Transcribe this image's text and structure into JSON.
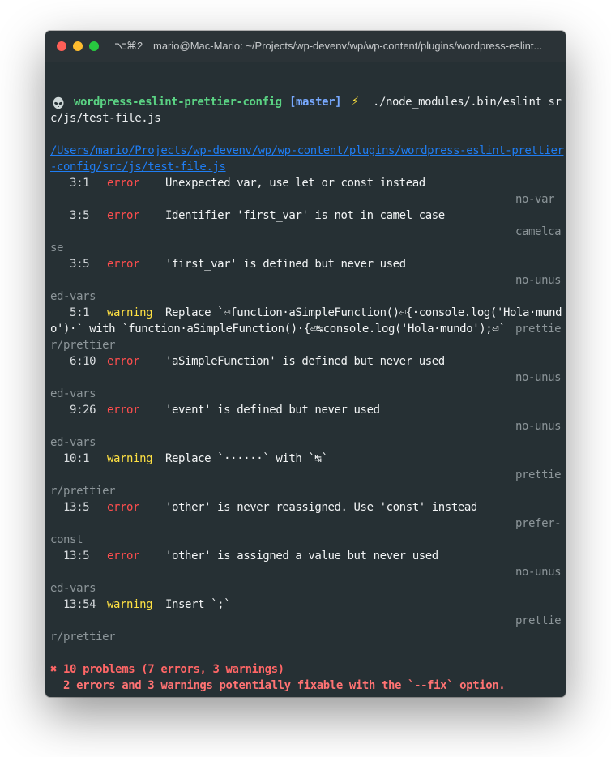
{
  "window": {
    "shortcut": "⌥⌘2",
    "title": "mario@Mac-Mario: ~/Projects/wp-devenv/wp/wp-content/plugins/wordpress-eslint..."
  },
  "prompt": {
    "project": "wordpress-eslint-prettier-config",
    "branch": "[master]",
    "command_part1": "./node_modules/.bin/eslint sr",
    "command_part2": "c/js/test-file.js"
  },
  "file_path": {
    "line1": "/Users/mario/Projects/wp-devenv/wp/wp-content/plugins/wordpress-eslint-prettier",
    "line2": "-config/src/js/test-file.js"
  },
  "problems": [
    {
      "pos": "   3:1",
      "severity": "error",
      "message": "Unexpected var, use let or const instead",
      "rule_a": "no-var",
      "rule_b": ""
    },
    {
      "pos": "   3:5",
      "severity": "error",
      "message": "Identifier 'first_var' is not in camel case",
      "rule_a": "camelca",
      "rule_b": "se"
    },
    {
      "pos": "   3:5",
      "severity": "error",
      "message": "'first_var' is defined but never used",
      "rule_a": "no-unus",
      "rule_b": "ed-vars"
    },
    {
      "pos": "   5:1",
      "severity": "warning",
      "message": "Replace `⏎function·aSimpleFunction()⏎{·console.log('Hola·mund",
      "message2": "o')·` with `function·aSimpleFunction()·{⏎↹console.log('Hola·mundo');⏎`",
      "rule_a": "prettie",
      "rule_b": "r/prettier"
    },
    {
      "pos": "   6:10",
      "severity": "error",
      "message": "'aSimpleFunction' is defined but never used",
      "rule_a": "no-unus",
      "rule_b": "ed-vars"
    },
    {
      "pos": "   9:26",
      "severity": "error",
      "message": "'event' is defined but never used",
      "rule_a": "no-unus",
      "rule_b": "ed-vars"
    },
    {
      "pos": "  10:1",
      "severity": "warning",
      "message": "Replace `······` with `↹`",
      "rule_a": "prettie",
      "rule_b": "r/prettier"
    },
    {
      "pos": "  13:5",
      "severity": "error",
      "message": "'other' is never reassigned. Use 'const' instead",
      "rule_a": "prefer-",
      "rule_b": "const"
    },
    {
      "pos": "  13:5",
      "severity": "error",
      "message": "'other' is assigned a value but never used",
      "rule_a": "no-unus",
      "rule_b": "ed-vars"
    },
    {
      "pos": "  13:54",
      "severity": "warning",
      "message": "Insert `;`",
      "rule_a": "prettie",
      "rule_b": "r/prettier"
    }
  ],
  "summary": {
    "line1": "✖ 10 problems (7 errors, 3 warnings)",
    "line2": "  2 errors and 3 warnings potentially fixable with the `--fix` option."
  },
  "colors": {
    "terminal_bg": "#263034",
    "prompt": "#5ad283",
    "branch": "#78a9ff",
    "error": "#ff4e4e",
    "warning": "#ffe143",
    "path": "#1f7df3",
    "rule": "#8c9599"
  },
  "icons": {
    "prompt_symbol": "alien-icon",
    "vcs_symbol": "lightning-icon"
  }
}
